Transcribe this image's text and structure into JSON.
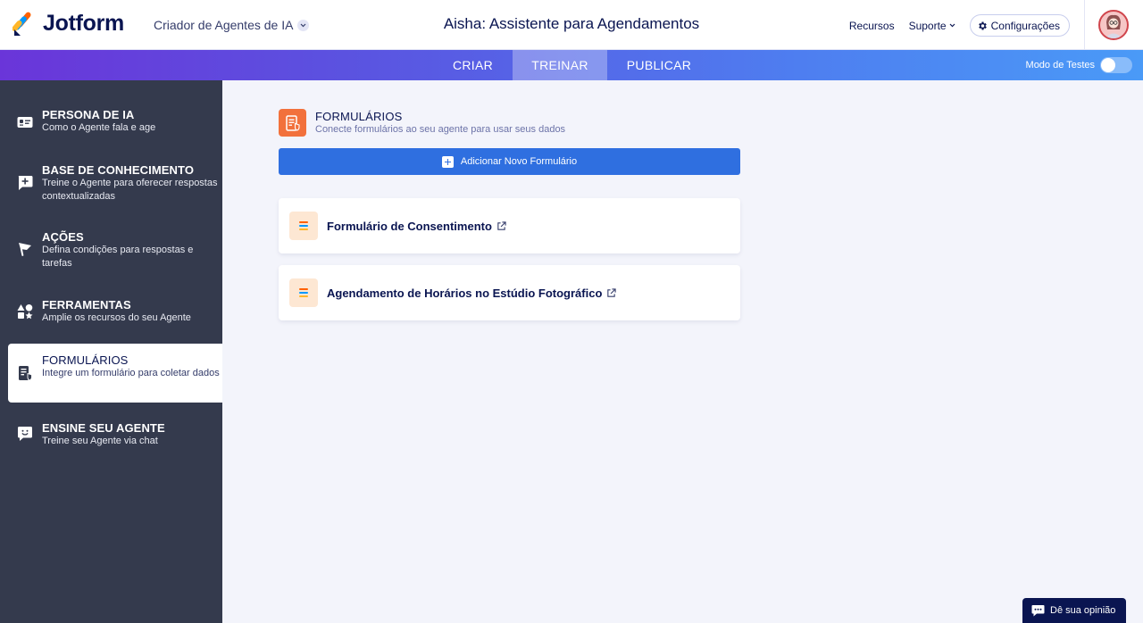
{
  "header": {
    "brand": "Jotform",
    "builder_name": "Criador de Agentes de IA",
    "agent_title": "Aisha: Assistente para Agendamentos",
    "links": {
      "resources": "Recursos",
      "support": "Suporte",
      "settings": "Configurações"
    }
  },
  "tabs": {
    "create": "CRIAR",
    "train": "TREINAR",
    "publish": "PUBLICAR",
    "active": "TREINAR"
  },
  "test_mode": {
    "label": "Modo de Testes",
    "enabled": false
  },
  "sidebar": {
    "items": [
      {
        "title": "PERSONA DE IA",
        "desc": "Como o Agente fala e age",
        "icon": "id-card-icon"
      },
      {
        "title": "BASE DE CONHECIMENTO",
        "desc": "Treine o Agente para oferecer respostas contextualizadas",
        "icon": "knowledge-plus-icon"
      },
      {
        "title": "AÇÕES",
        "desc": "Defina condições para respostas e tarefas",
        "icon": "flag-icon"
      },
      {
        "title": "FERRAMENTAS",
        "desc": "Amplie os recursos do seu Agente",
        "icon": "shapes-icon"
      },
      {
        "title": "FORMULÁRIOS",
        "desc": "Integre um formulário para coletar dados",
        "icon": "form-icon",
        "active": true
      },
      {
        "title": "ENSINE SEU AGENTE",
        "desc": "Treine seu Agente via chat",
        "icon": "chat-smile-icon"
      }
    ]
  },
  "main": {
    "section_title": "FORMULÁRIOS",
    "section_subtitle": "Conecte formulários ao seu agente para usar seus dados",
    "add_button": "Adicionar Novo Formulário",
    "forms": [
      {
        "name": "Formulário de Consentimento"
      },
      {
        "name": "Agendamento de Horários no Estúdio Fotográfico"
      }
    ]
  },
  "feedback": {
    "label": "Dê sua opinião"
  },
  "colors": {
    "brand_navy": "#0a1551",
    "sidebar_bg": "#343a4d",
    "primary_blue": "#2f6fe0",
    "forms_orange": "#f2713c"
  }
}
